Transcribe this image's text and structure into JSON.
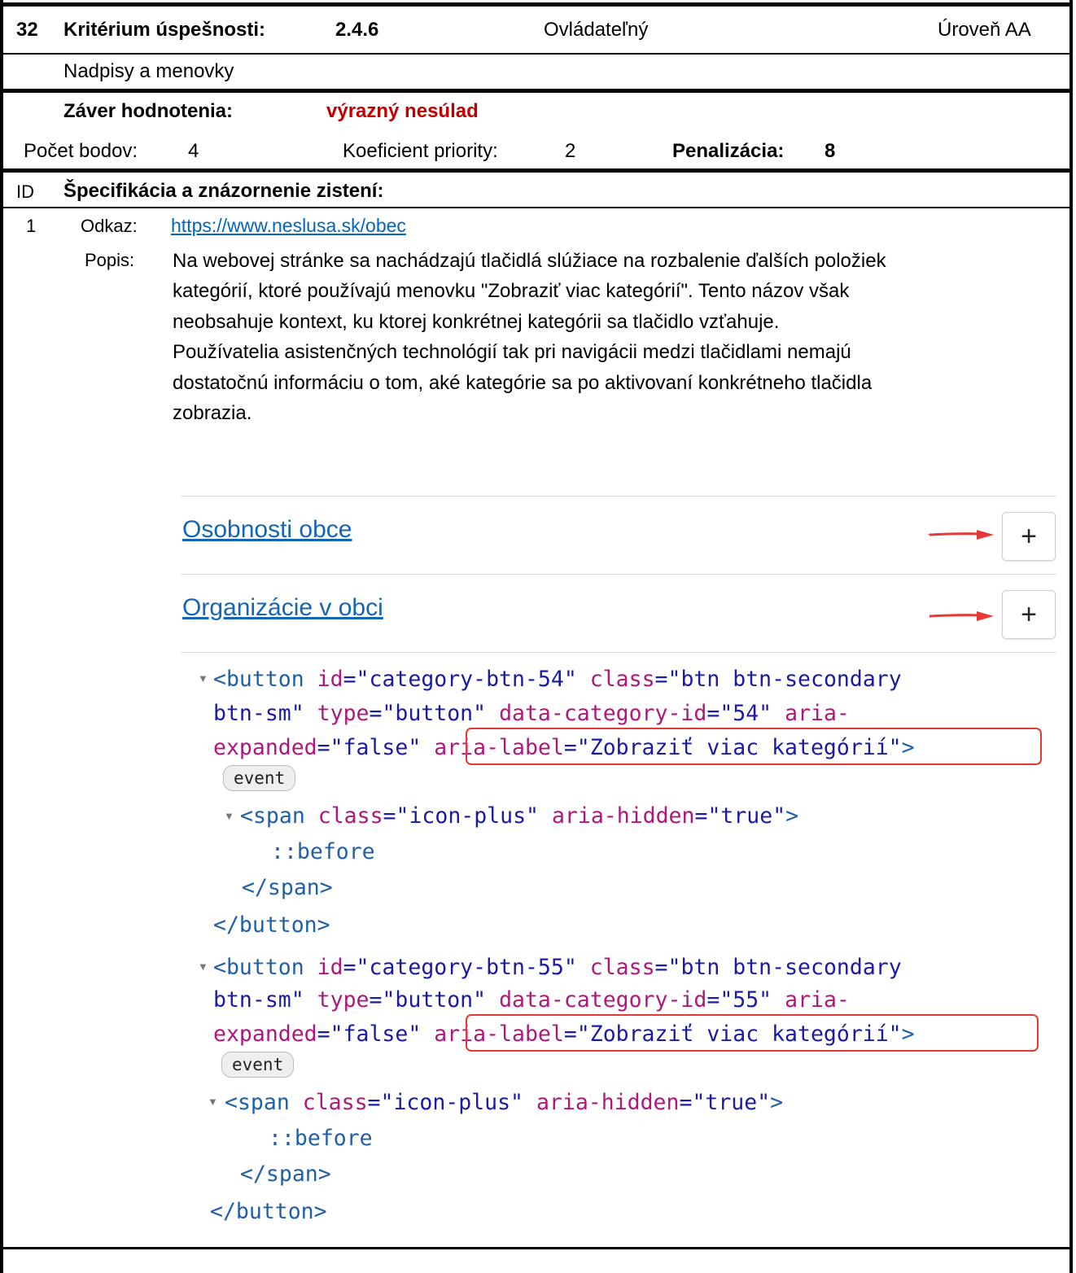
{
  "header": {
    "number": "32",
    "criterion_label": "Kritérium úspešnosti:",
    "criterion_code": "2.4.6",
    "principle": "Ovládateľný",
    "level": "Úroveň AA",
    "criterion_name": "Nadpisy a menovky"
  },
  "evaluation": {
    "conclusion_label": "Záver hodnotenia:",
    "conclusion_value": "výrazný nesúlad",
    "points_label": "Počet bodov:",
    "points_value": "4",
    "priority_label": "Koeficient priority:",
    "priority_value": "2",
    "penalty_label": "Penalizácia:",
    "penalty_value": "8"
  },
  "findings_header": {
    "id_label": "ID",
    "title": "Špecifikácia a znázornenie zistení:"
  },
  "finding": {
    "id": "1",
    "link_label": "Odkaz:",
    "link_url": "https://www.neslusa.sk/obec",
    "desc_label": "Popis:",
    "desc_lines": [
      "Na webovej stránke sa nachádzajú tlačidlá slúžiace na rozbalenie ďalších položiek",
      "kategórií, ktoré používajú menovku \"Zobraziť viac kategórií\". Tento názov však",
      "neobsahuje kontext, ku ktorej konkrétnej kategórii sa tlačidlo vzťahuje.",
      "Používatelia asistenčných technológií tak pri navigácii medzi tlačidlami nemajú",
      "dostatočnú informáciu o tom, aké kategórie sa po aktivovaní konkrétneho tlačidla",
      "zobrazia."
    ]
  },
  "screenshot": {
    "categories": [
      "Osobnosti obce",
      "Organizácie v obci"
    ],
    "plus_glyph": "+",
    "code_blocks": [
      {
        "btn_open": "<button",
        "id_attr": "id",
        "id_val": "\"category-btn-54\"",
        "class_attr": "class",
        "class_val_1": "\"btn btn-secondary",
        "class_val_2": "btn-sm\"",
        "type_attr": "type",
        "type_val": "\"button\"",
        "dcid_attr": "data-category-id",
        "dcid_val": "\"54\"",
        "aria_exp_1": "aria-",
        "aria_exp_2": "expanded",
        "aria_exp_val": "\"false\"",
        "aria_label_attr": "aria-label",
        "aria_label_val": "\"Zobraziť viac kategórií\"",
        "close": ">",
        "event": "event",
        "span_open": "<span",
        "span_class_attr": "class",
        "span_class_val": "\"icon-plus\"",
        "span_hidden_attr": "aria-hidden",
        "span_hidden_val": "\"true\"",
        "span_close_bracket": ">",
        "before": "::before",
        "span_end": "</span>",
        "btn_end": "</button>"
      },
      {
        "btn_open": "<button",
        "id_attr": "id",
        "id_val": "\"category-btn-55\"",
        "class_attr": "class",
        "class_val_1": "\"btn btn-secondary",
        "class_val_2": "btn-sm\"",
        "type_attr": "type",
        "type_val": "\"button\"",
        "dcid_attr": "data-category-id",
        "dcid_val": "\"55\"",
        "aria_exp_1": "aria-",
        "aria_exp_2": "expanded",
        "aria_exp_val": "\"false\"",
        "aria_label_attr": "aria-label",
        "aria_label_val": "\"Zobraziť viac kategórií\"",
        "close": ">",
        "event": "event",
        "span_open": "<span",
        "span_class_attr": "class",
        "span_class_val": "\"icon-plus\"",
        "span_hidden_attr": "aria-hidden",
        "span_hidden_val": "\"true\"",
        "span_close_bracket": ">",
        "before": "::before",
        "span_end": "</span>",
        "btn_end": "</button>"
      }
    ]
  },
  "colors": {
    "conclusion": "#c00000",
    "link": "#0563c1",
    "highlight_box": "#e53935",
    "arrow": "#e53935"
  }
}
